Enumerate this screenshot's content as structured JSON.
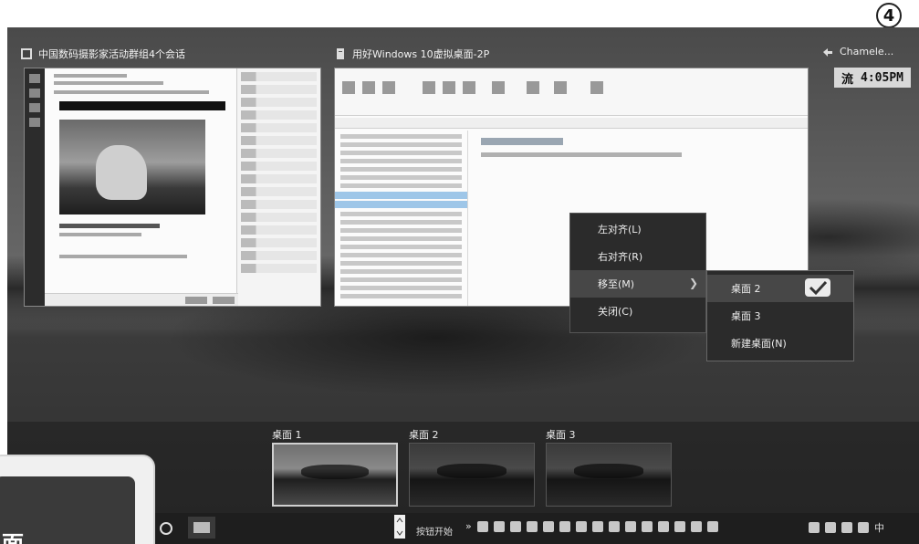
{
  "step_badge": "4",
  "windows": {
    "left_title": "中国数码摄影家活动群组4个会话",
    "mid_title": "用好Windows 10虚拟桌面-2P",
    "right_title": "Chamele..."
  },
  "clock": {
    "prefix": "流",
    "time": "4:05PM"
  },
  "context_menu": {
    "items": [
      {
        "label": "左对齐(L)"
      },
      {
        "label": "右对齐(R)"
      },
      {
        "label": "移至(M)",
        "has_submenu": true
      },
      {
        "label": "关闭(C)"
      }
    ],
    "submenu": [
      {
        "label": "桌面 2",
        "checked": true
      },
      {
        "label": "桌面 3"
      },
      {
        "label": "新建桌面(N)"
      }
    ]
  },
  "desktops": [
    {
      "label": "桌面 1",
      "selected": true
    },
    {
      "label": "桌面 2"
    },
    {
      "label": "桌面 3"
    }
  ],
  "taskbar": {
    "start_label": "按钮开始",
    "ime": "中"
  },
  "overlay": {
    "text": "面"
  }
}
